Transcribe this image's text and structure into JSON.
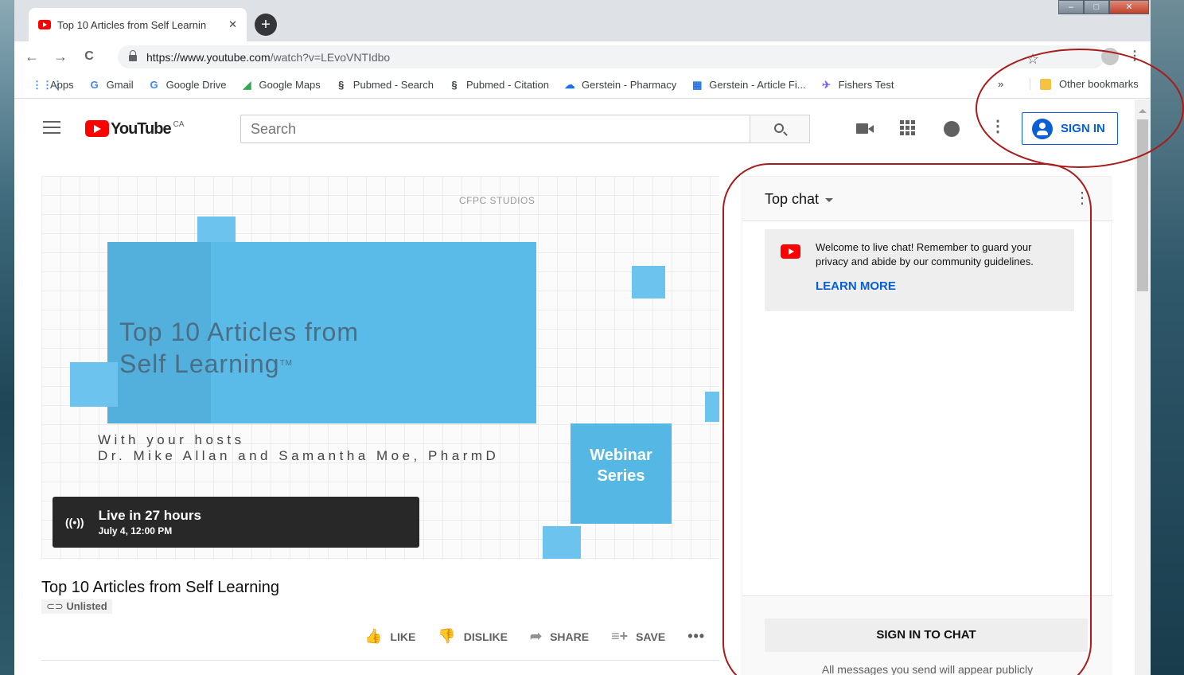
{
  "browser": {
    "tab_title": "Top 10 Articles from Self Learnin",
    "tab_close": "✕",
    "new_tab": "+",
    "window_controls": [
      "–",
      "□",
      "✕"
    ],
    "nav": {
      "back": "←",
      "forward": "→",
      "reload": "C"
    },
    "url_host": "https://www.youtube.com",
    "url_path": "/watch?v=LEvoVNTIdbo",
    "star": "☆",
    "menu": "⋮"
  },
  "bookmarks": {
    "items": [
      {
        "label": "Apps",
        "icon": "apps-grid-icon",
        "glyph": "⋮⋮⋮",
        "color": "#4285f4"
      },
      {
        "label": "Gmail",
        "icon": "google-g-icon",
        "glyph": "G",
        "color": "#4285f4"
      },
      {
        "label": "Google Drive",
        "icon": "google-g-icon",
        "glyph": "G",
        "color": "#4285f4"
      },
      {
        "label": "Google Maps",
        "icon": "maps-pin-icon",
        "glyph": "◢",
        "color": "#34a853"
      },
      {
        "label": "Pubmed - Search",
        "icon": "pubmed-icon",
        "glyph": "§",
        "color": "#3c4043"
      },
      {
        "label": "Pubmed - Citation",
        "icon": "pubmed-icon",
        "glyph": "§",
        "color": "#3c4043"
      },
      {
        "label": "Gerstein - Pharmacy",
        "icon": "cloud-icon",
        "glyph": "☁",
        "color": "#1a73e8"
      },
      {
        "label": "Gerstein - Article Fi...",
        "icon": "building-icon",
        "glyph": "▦",
        "color": "#1a73e8"
      },
      {
        "label": "Fishers Test",
        "icon": "bird-icon",
        "glyph": "✈",
        "color": "#7b68ee"
      }
    ],
    "overflow": "»",
    "other": "Other bookmarks"
  },
  "youtube": {
    "logo_text": "YouTube",
    "region": "CA",
    "search_placeholder": "Search",
    "more": "⋮",
    "sign_in": "SIGN IN",
    "colors": {
      "brand": "#ff0000",
      "accent": "#065fd4"
    }
  },
  "video": {
    "studios": "CFPC STUDIOS",
    "title_line1": "Top 10 Articles from",
    "title_line2": "Self Learning",
    "trademark": "TM",
    "hosts_line1": "With your hosts",
    "hosts_line2": "Dr. Mike Allan and Samantha Moe, PharmD",
    "webinar_line1": "Webinar",
    "webinar_line2": "Series",
    "live_icon": "((•))",
    "live_main": "Live in 27 hours",
    "live_sub": "July 4, 12:00 PM"
  },
  "info": {
    "title": "Top 10 Articles from Self Learning",
    "visibility": "Unlisted",
    "actions": [
      {
        "label": "LIKE",
        "glyph": "👍",
        "icon": "thumbs-up-icon"
      },
      {
        "label": "DISLIKE",
        "glyph": "👎",
        "icon": "thumbs-down-icon"
      },
      {
        "label": "SHARE",
        "glyph": "➦",
        "icon": "share-icon"
      },
      {
        "label": "SAVE",
        "glyph": "≡+",
        "icon": "playlist-add-icon"
      }
    ],
    "more": "•••"
  },
  "chat": {
    "header": "Top chat",
    "menu": "⋮",
    "welcome": "Welcome to live chat! Remember to guard your privacy and abide by our community guidelines.",
    "learn_more": "LEARN MORE",
    "sign_in": "SIGN IN TO CHAT",
    "public_note": "All messages you send will appear publicly"
  },
  "annotation_color": "#a81c1c"
}
